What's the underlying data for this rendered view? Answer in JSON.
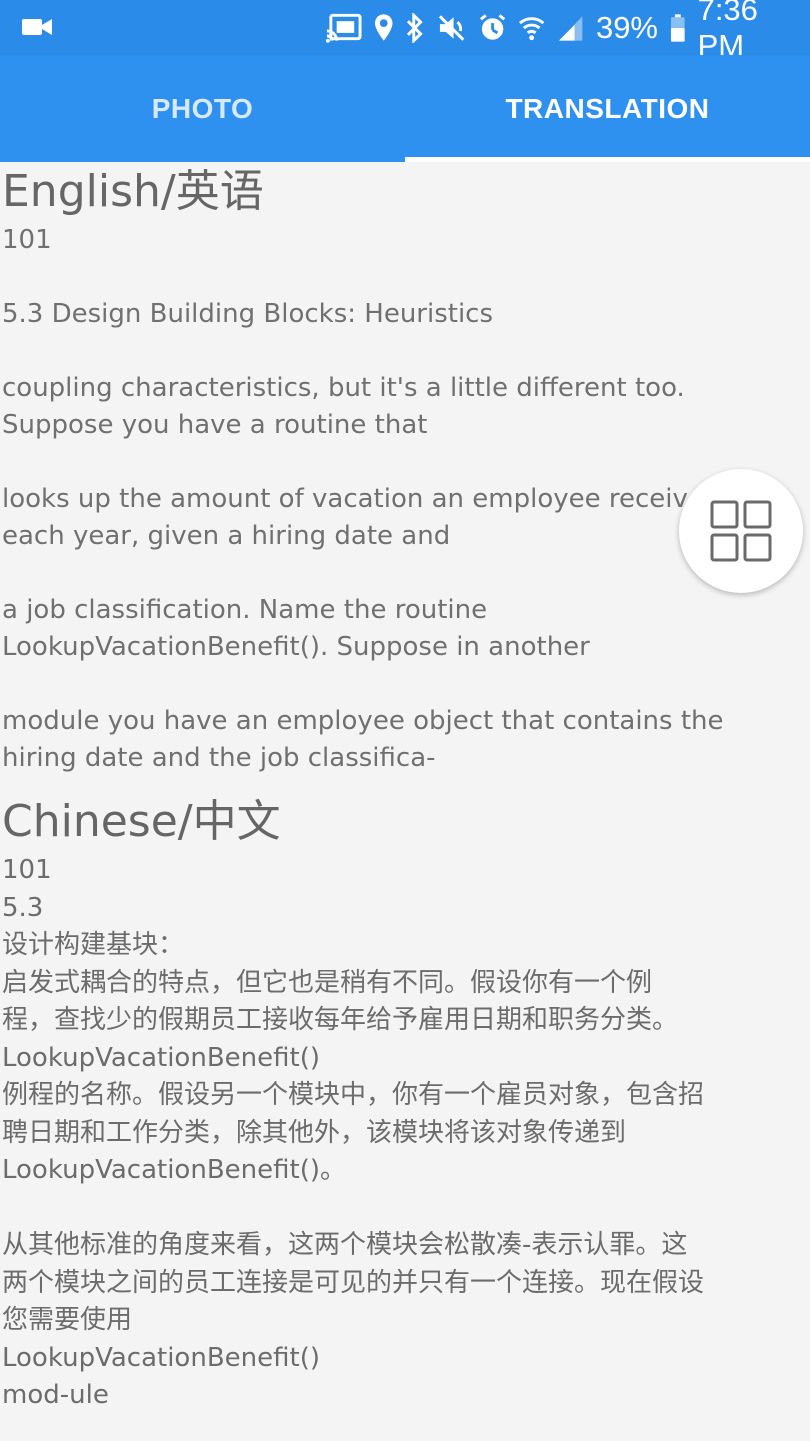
{
  "status_bar": {
    "battery_percent": "39%",
    "time": "7:36 PM",
    "icons": [
      "video-camera-icon",
      "cast-icon",
      "location-pin-icon",
      "bluetooth-icon",
      "mute-icon",
      "alarm-icon",
      "wifi-icon",
      "signal-icon",
      "battery-icon"
    ]
  },
  "tabs": [
    {
      "label": "PHOTO",
      "selected": false
    },
    {
      "label": "TRANSLATION",
      "selected": true
    }
  ],
  "english": {
    "title": "English/英语",
    "paragraphs": [
      "101",
      "5.3 Design Building Blocks: Heuristics",
      "coupling characteristics, but it's a little different too.\nSuppose you have a routine that",
      "looks up the amount of vacation an employee receives\neach year, given a hiring date and",
      "a job classification. Name the routine\nLookupVacationBenefit(). Suppose in another",
      "module you have an employee object that contains the\nhiring date and the job classifica-"
    ]
  },
  "chinese": {
    "title": "Chinese/中文",
    "body": "101\n5.3\n设计构建基块：\n启发式耦合的特点，但它也是稍有不同。假设你有一个例\n程，查找少的假期员工接收每年给予雇用日期和职务分类。\nLookupVacationBenefit()\n例程的名称。假设另一个模块中，你有一个雇员对象，包含招\n聘日期和工作分类，除其他外，该模块将该对象传递到\nLookupVacationBenefit()。\n\n从其他标准的角度来看，这两个模块会松散凑-表示认罪。这\n两个模块之间的员工连接是可见的并只有一个连接。现在假设\n您需要使用\nLookupVacationBenefit()\nmod-ule"
  },
  "fab": {
    "icon": "grid-icon"
  },
  "colors": {
    "status_bar": "#2b8be9",
    "tab_bar": "#2e91f0",
    "background": "#f4f4f4"
  }
}
